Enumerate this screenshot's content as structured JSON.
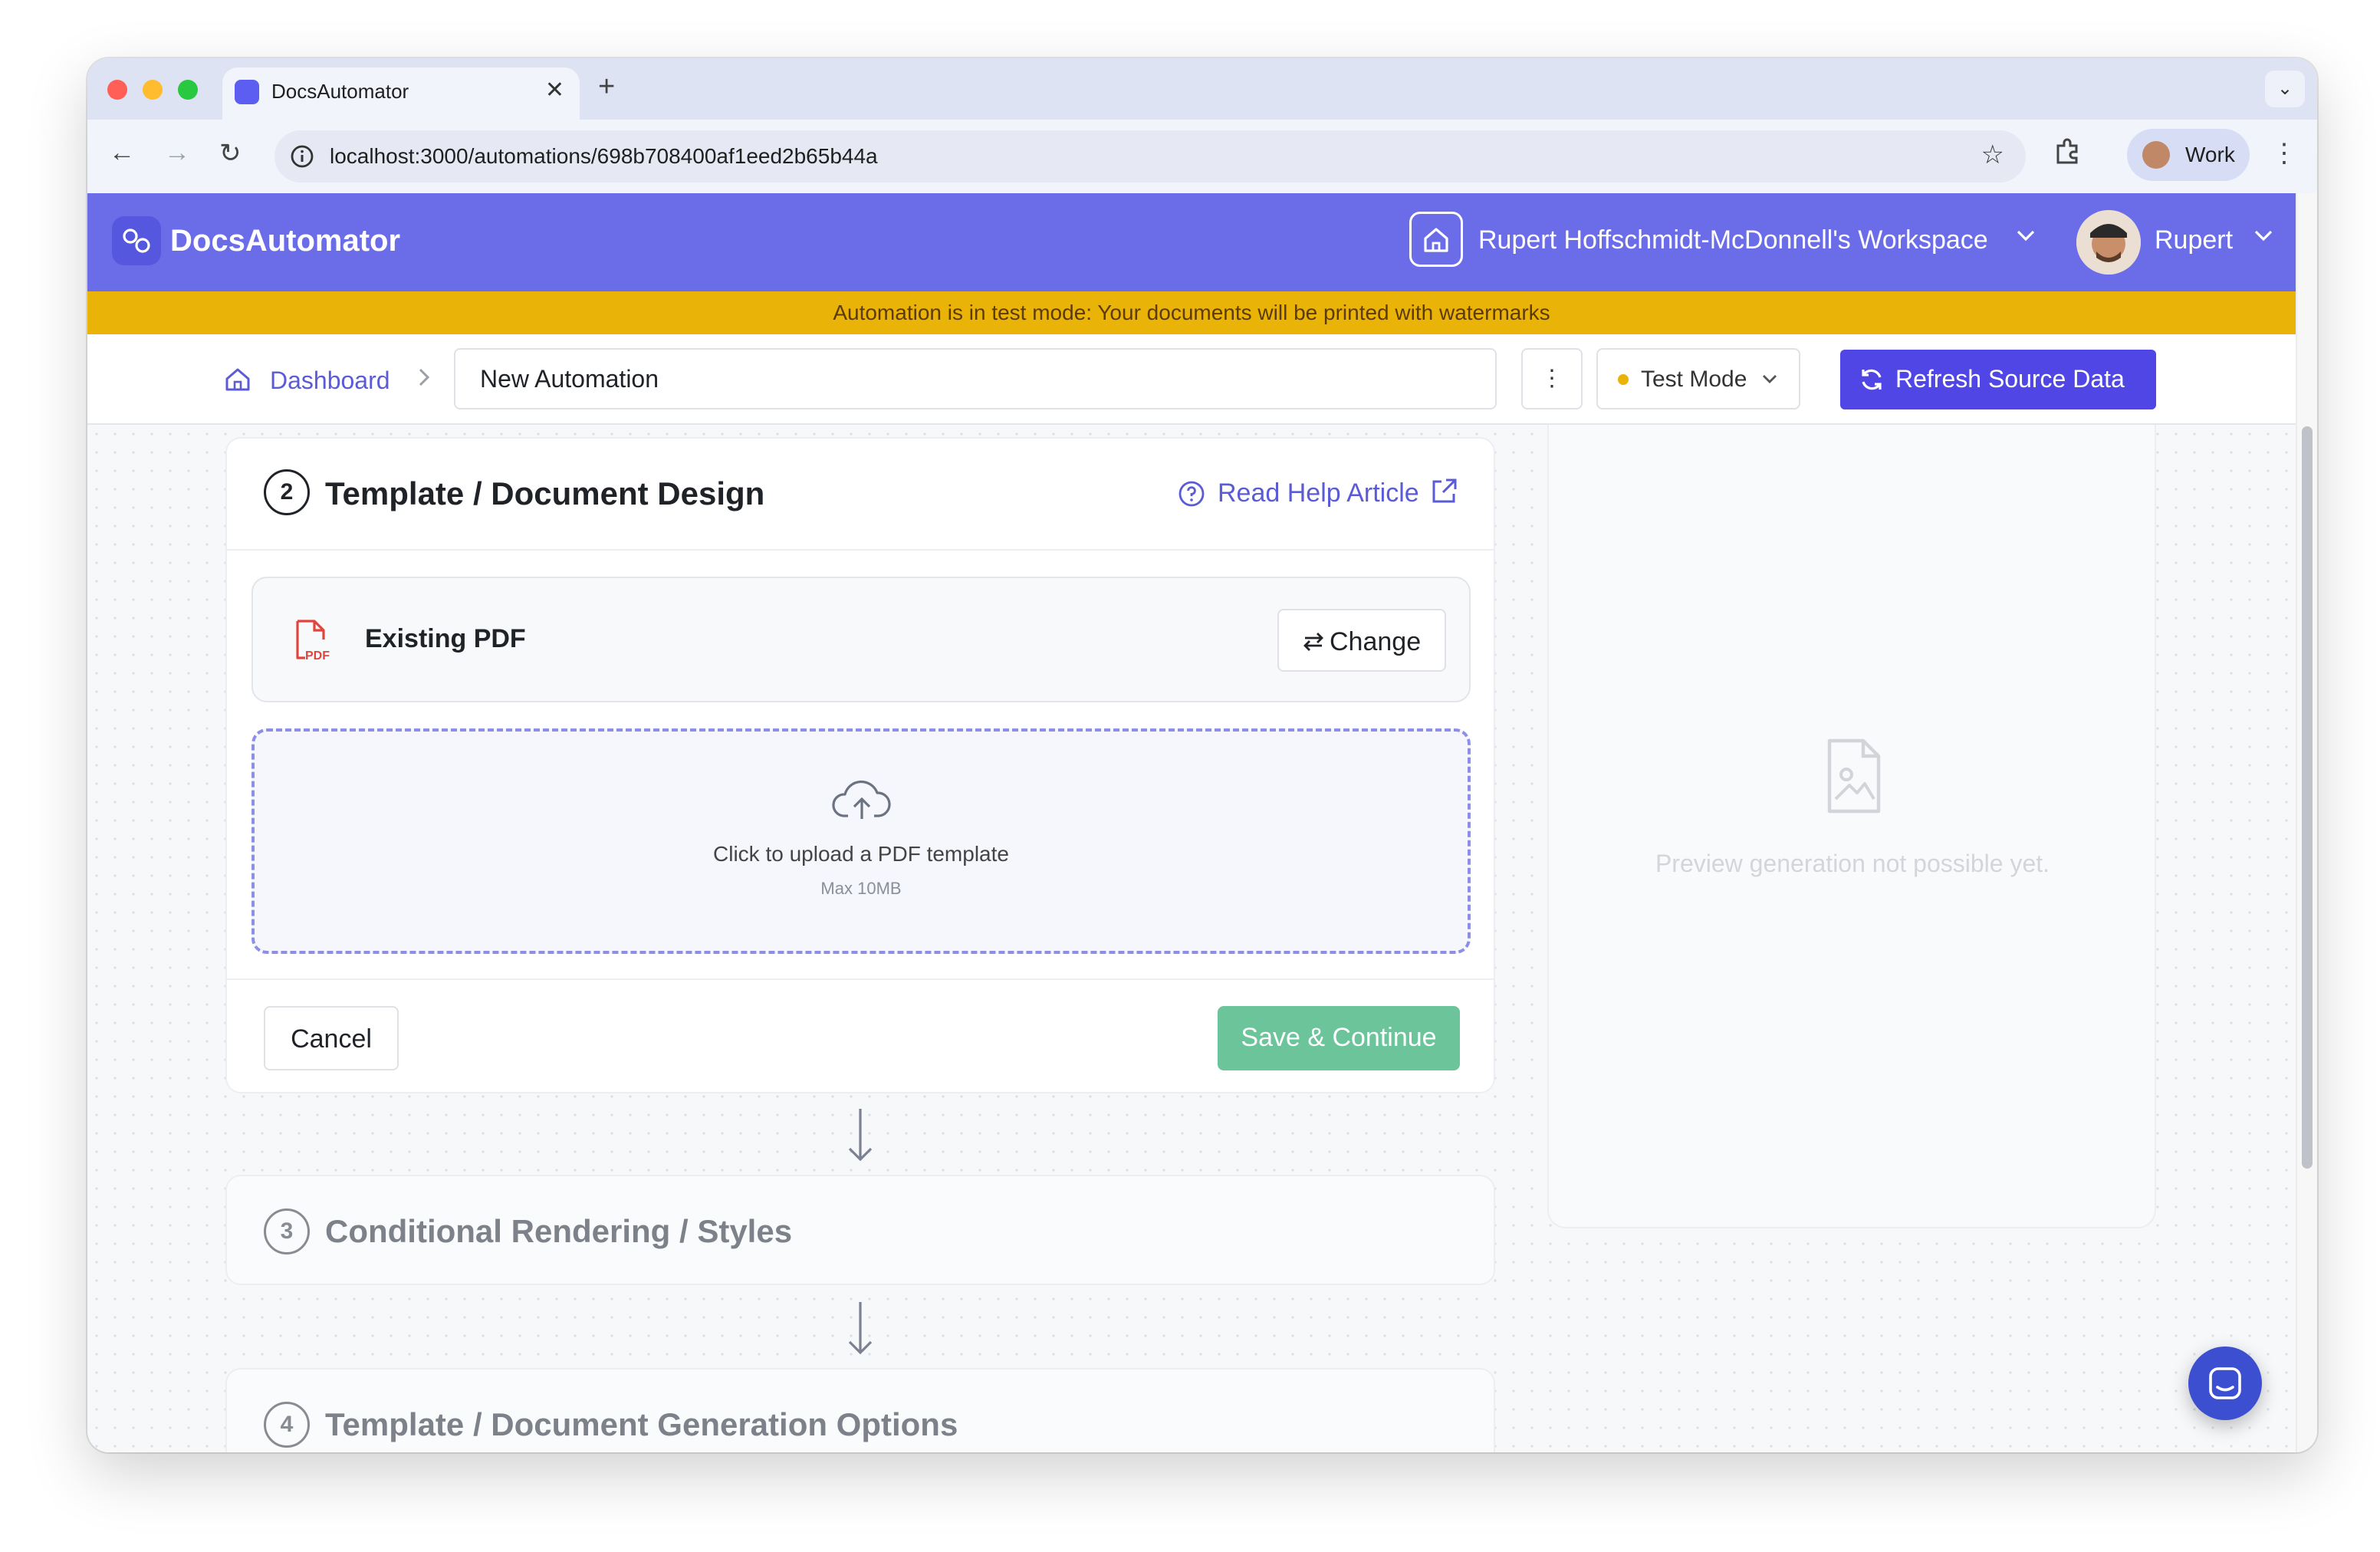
{
  "browser": {
    "tab_title": "DocsAutomator",
    "url": "localhost:3000/automations/698b708400af1eed2b65b44a",
    "profile_label": "Work"
  },
  "app": {
    "brand": "DocsAutomator",
    "workspace": "Rupert Hoffschmidt-McDonnell's Workspace",
    "user": "Rupert"
  },
  "banner": {
    "text": "Automation is in test mode: Your documents will be printed with watermarks",
    "color": "#eab308"
  },
  "toolbar": {
    "breadcrumb_home": "Dashboard",
    "automation_name": "New Automation",
    "mode_label": "Test Mode",
    "refresh_label": "Refresh Source Data",
    "accent": "#4f46e5"
  },
  "steps": {
    "current": {
      "number": "2",
      "title": "Template / Document Design",
      "help_label": "Read Help Article",
      "source_label": "Existing PDF",
      "change_label": "Change",
      "upload_text": "Click to upload a PDF template",
      "upload_limit": "Max 10MB",
      "cancel_label": "Cancel",
      "save_label": "Save & Continue"
    },
    "next": {
      "number": "3",
      "title": "Conditional Rendering / Styles"
    },
    "after": {
      "number": "4",
      "title": "Template / Document Generation Options"
    }
  },
  "preview": {
    "empty_text": "Preview generation not possible yet."
  },
  "icons": [
    "home-icon",
    "chevron-right-icon",
    "more-vertical-icon",
    "refresh-icon",
    "help-circle-icon",
    "external-link-icon",
    "pdf-file-icon",
    "swap-icon",
    "cloud-upload-icon",
    "arrow-down-icon",
    "image-file-icon",
    "chat-icon"
  ]
}
